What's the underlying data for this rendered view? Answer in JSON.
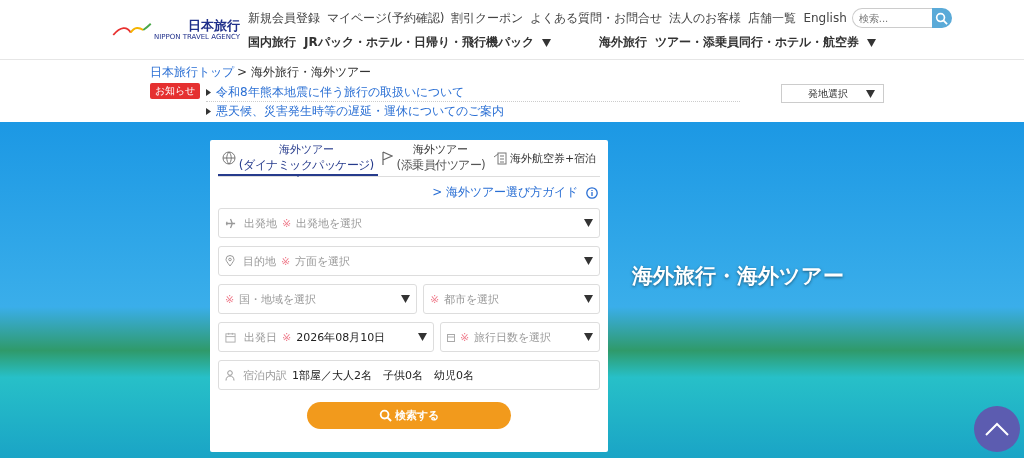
{
  "header": {
    "logo": {
      "text": "日本旅行",
      "subtext": "NIPPON TRAVEL AGENCY"
    },
    "top_links": [
      "新規会員登録",
      "マイページ(予約確認)",
      "割引クーポン",
      "よくある質問・お問合せ",
      "法人のお客様",
      "店舗一覧",
      "English"
    ],
    "search": {
      "placeholder": "検索..."
    },
    "nav": [
      {
        "title": "国内旅行",
        "sub": "JRパック・ホテル・日帰り・飛行機パック"
      },
      {
        "title": "海外旅行",
        "sub": "ツアー・添乗員同行・ホテル・航空券"
      }
    ]
  },
  "breadcrumb": [
    {
      "label": "日本旅行トップ",
      "link": true
    },
    {
      "label": "> 海外旅行・海外ツアー",
      "link": false
    }
  ],
  "notices": {
    "badge": "お知らせ",
    "items": [
      "令和8年熊本地震に伴う旅行の取扱いについて",
      "悪天候、災害発生時等の遅延・運休についてのご案内"
    ]
  },
  "departure_select": {
    "label": "発地選択"
  },
  "hero": {
    "title": "海外旅行・海外ツアー"
  },
  "search_form": {
    "tabs": [
      {
        "kind": "globe",
        "title": "海外ツアー",
        "sub": "(ダイナミックパッケージ)",
        "selected": true
      },
      {
        "kind": "flag",
        "title": "海外ツアー",
        "sub": "(添乗員付ツアー)",
        "selected": false
      },
      {
        "kind": "hotel",
        "title": "海外航空券+宿泊",
        "selected": false
      }
    ],
    "guide_link": "> 海外ツアー選び方ガイド",
    "rows": [
      [
        {
          "kind": "plane",
          "label": "出発地",
          "mark": "※",
          "placeholder": "出発地を選択",
          "dropdown": true
        }
      ],
      [
        {
          "kind": "pin",
          "label": "目的地",
          "mark": "※",
          "placeholder": "方面を選択",
          "dropdown": true
        }
      ],
      [
        {
          "kind": "none",
          "mark": "※",
          "placeholder": "国・地域を選択",
          "dropdown": true
        },
        {
          "kind": "none",
          "mark": "※",
          "placeholder": "都市を選択",
          "dropdown": true
        }
      ],
      [
        {
          "kind": "calendar",
          "label": "出発日",
          "mark": "※",
          "value": "2026年08月10日",
          "dropdown": true
        },
        {
          "kind": "small-calendar",
          "mark": "※",
          "placeholder": "旅行日数を選択",
          "dropdown": true
        }
      ],
      [
        {
          "kind": "person",
          "label": "宿泊内訳",
          "value": "1部屋／大人2名　子供0名　幼児0名",
          "dropdown": false
        }
      ]
    ],
    "submit": "検索する"
  }
}
